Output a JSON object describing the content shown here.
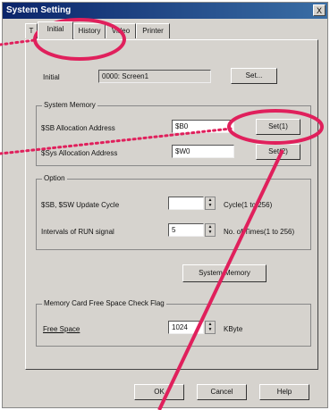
{
  "window": {
    "title": "System Setting",
    "close_glyph": "X"
  },
  "tabs": [
    {
      "label": "T"
    },
    {
      "label": "Initial"
    },
    {
      "label": "History"
    },
    {
      "label": "Video"
    },
    {
      "label": "Printer"
    }
  ],
  "initial": {
    "label": "Initial",
    "value": "0000: Screen1",
    "set_label": "Set..."
  },
  "system_memory": {
    "title": "System Memory",
    "sb_label": "$SB Allocation Address",
    "sb_value": "$B0",
    "sb_set": "Set(1)",
    "sys_label": "$Sys Allocation Address",
    "sys_value": "$W0",
    "sys_set": "Set(2)"
  },
  "option": {
    "title": "Option",
    "cycle_label": "$SB, $SW Update Cycle",
    "cycle_value": "",
    "cycle_unit": "Cycle(1 to 256)",
    "run_label": "Intervals of RUN signal",
    "run_value": "5",
    "run_unit": "No. of Times(1 to 256)"
  },
  "system_memory_button": "System Memory",
  "memcard": {
    "title": "Memory Card Free Space Check Flag",
    "free_label": "Free Space",
    "free_value": "1024",
    "free_unit": "KByte"
  },
  "footer": {
    "ok": "OK",
    "cancel": "Cancel",
    "help": "Help"
  },
  "annotation_color": "#e0205c"
}
